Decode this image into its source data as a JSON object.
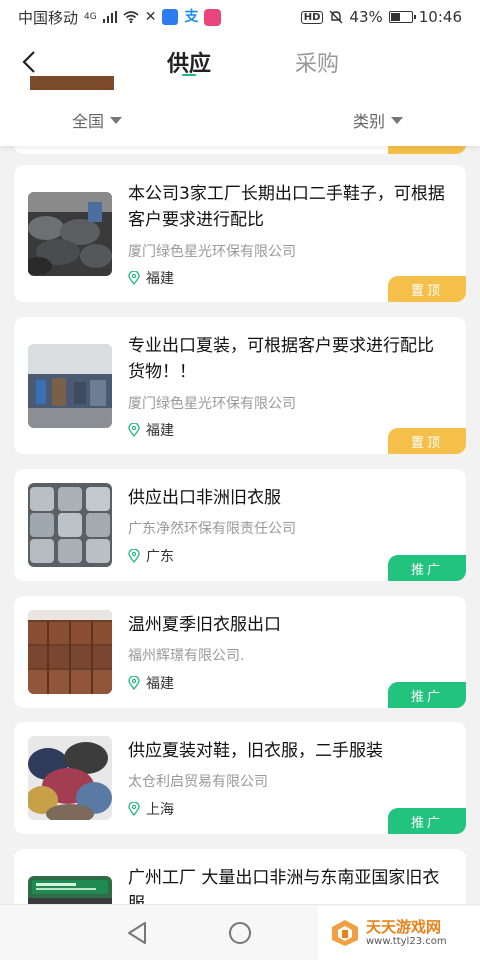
{
  "status": {
    "carrier": "中国移动",
    "network": "4G",
    "battery": "43%",
    "battery_level": 0.43,
    "time": "10:46",
    "hd": "HD",
    "alipay_icon": "支"
  },
  "header": {
    "tabs": [
      {
        "label": "供应",
        "active": true
      },
      {
        "label": "采购",
        "active": false
      }
    ]
  },
  "filters": {
    "region": "全国",
    "category": "类别"
  },
  "listings": [
    {
      "title": "本公司3家工厂长期出口二手鞋子，可根据客户要求进行配比",
      "company": "厦门绿色星光环保有限公司",
      "location": "福建",
      "badge": "置顶",
      "badge_type": "top",
      "thumb": "shoe-bales"
    },
    {
      "title": "专业出口夏装，可根据客户要求进行配比货物！！",
      "company": "厦门绿色星光环保有限公司",
      "location": "福建",
      "badge": "置顶",
      "badge_type": "top",
      "thumb": "warehouse"
    },
    {
      "title": "供应出口非洲旧衣服",
      "company": "广东净然环保有限责任公司",
      "location": "广东",
      "badge": "推广",
      "badge_type": "promo",
      "thumb": "clothing-bales"
    },
    {
      "title": "温州夏季旧衣服出口",
      "company": "福州辉璟有限公司.",
      "location": "福建",
      "badge": "推广",
      "badge_type": "promo",
      "thumb": "brown-bales"
    },
    {
      "title": "供应夏装对鞋，旧衣服，二手服装",
      "company": "太仓利启贸易有限公司",
      "location": "上海",
      "badge": "推广",
      "badge_type": "promo",
      "thumb": "clothes-pile"
    },
    {
      "title": "广州工厂 大量出口非洲与东南亚国家旧衣服",
      "company": "",
      "location": "",
      "badge": "",
      "badge_type": "",
      "thumb": "green-sign"
    }
  ],
  "watermark": {
    "name": "天天游戏网",
    "url": "www.ttyl23.com"
  },
  "colors": {
    "accent": "#20b77a",
    "badge_top": "#f5c04a",
    "badge_promo": "#22c37f"
  }
}
